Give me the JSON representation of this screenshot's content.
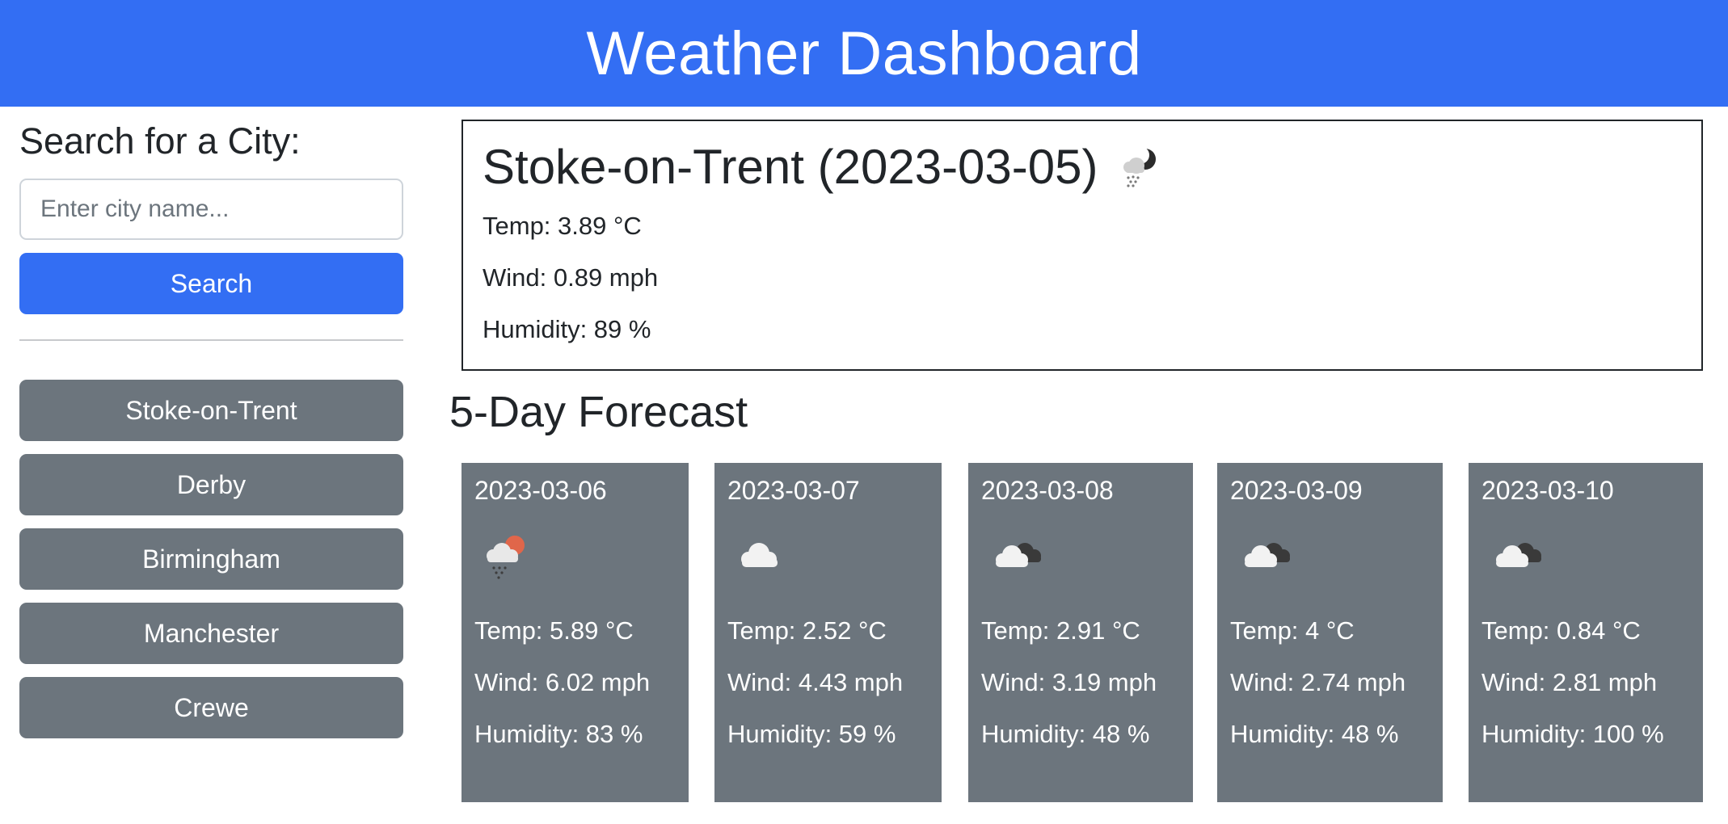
{
  "header": {
    "title": "Weather Dashboard"
  },
  "search": {
    "title": "Search for a City:",
    "placeholder": "Enter city name...",
    "value": "",
    "button_label": "Search"
  },
  "history": [
    "Stoke-on-Trent",
    "Derby",
    "Birmingham",
    "Manchester",
    "Crewe"
  ],
  "current": {
    "title": "Stoke-on-Trent (2023-03-05)",
    "icon": "snow-cloud-night-icon",
    "temp": "Temp: 3.89 °C",
    "wind": "Wind: 0.89 mph",
    "humidity": "Humidity: 89 %"
  },
  "forecast": {
    "title": "5-Day Forecast",
    "days": [
      {
        "date": "2023-03-06",
        "icon": "rain-sun-cloud-icon",
        "temp": "Temp: 5.89 °C",
        "wind": "Wind: 6.02 mph",
        "humidity": "Humidity: 83 %"
      },
      {
        "date": "2023-03-07",
        "icon": "cloud-icon",
        "temp": "Temp: 2.52 °C",
        "wind": "Wind: 4.43 mph",
        "humidity": "Humidity: 59 %"
      },
      {
        "date": "2023-03-08",
        "icon": "broken-clouds-icon",
        "temp": "Temp: 2.91 °C",
        "wind": "Wind: 3.19 mph",
        "humidity": "Humidity: 48 %"
      },
      {
        "date": "2023-03-09",
        "icon": "broken-clouds-icon",
        "temp": "Temp: 4 °C",
        "wind": "Wind: 2.74 mph",
        "humidity": "Humidity: 48 %"
      },
      {
        "date": "2023-03-10",
        "icon": "broken-clouds-icon",
        "temp": "Temp: 0.84 °C",
        "wind": "Wind: 2.81 mph",
        "humidity": "Humidity: 100 %"
      }
    ]
  }
}
